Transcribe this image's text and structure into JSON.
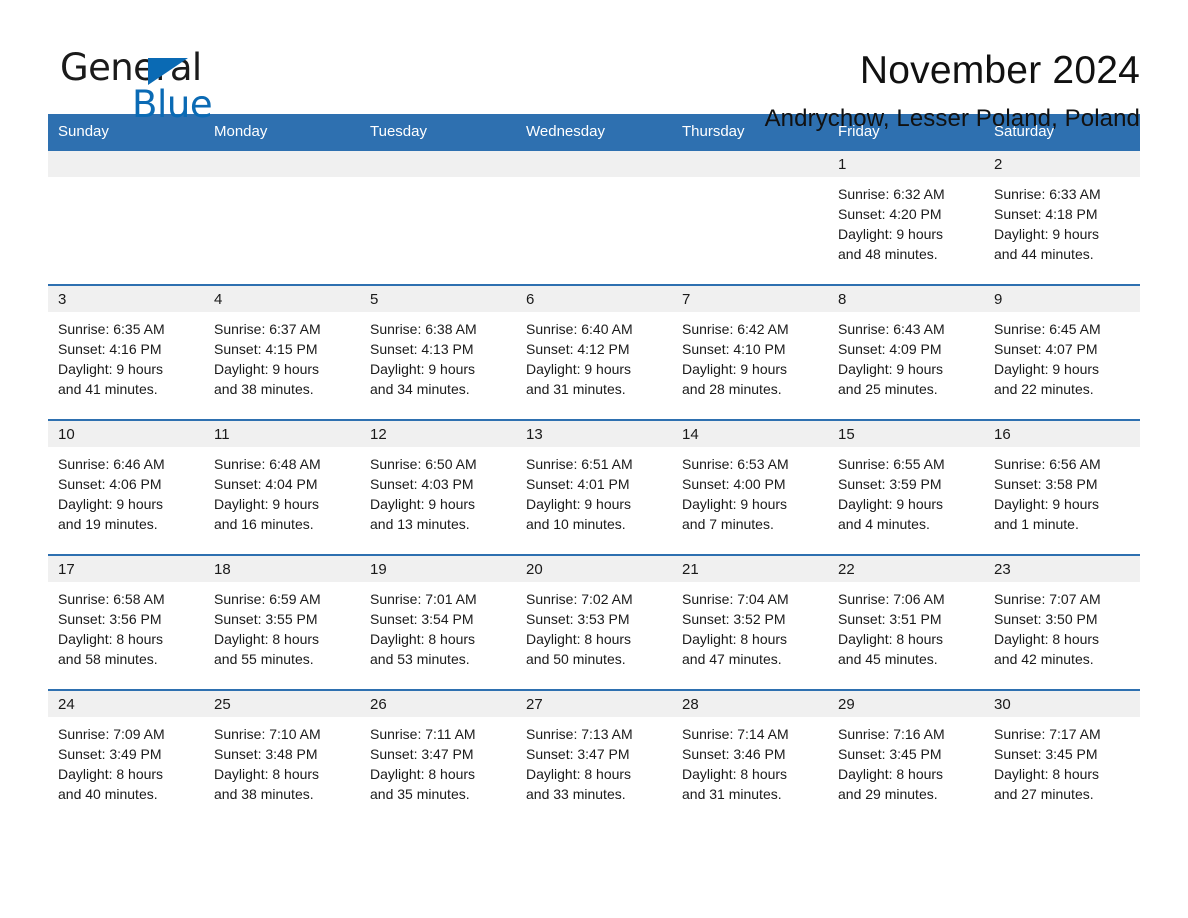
{
  "brand": {
    "name_top": "General",
    "name_bottom": "Blue",
    "accent_color": "#0a6ab4"
  },
  "header": {
    "title": "November 2024",
    "subtitle": "Andrychow, Lesser Poland, Poland"
  },
  "theme": {
    "header_blue": "#2e70b0",
    "daynum_band_gray": "#f0f0f0",
    "page_background": "#ffffff"
  },
  "weekdays": [
    "Sunday",
    "Monday",
    "Tuesday",
    "Wednesday",
    "Thursday",
    "Friday",
    "Saturday"
  ],
  "weeks": [
    [
      {
        "day": "",
        "lines": []
      },
      {
        "day": "",
        "lines": []
      },
      {
        "day": "",
        "lines": []
      },
      {
        "day": "",
        "lines": []
      },
      {
        "day": "",
        "lines": []
      },
      {
        "day": "1",
        "lines": [
          "Sunrise: 6:32 AM",
          "Sunset: 4:20 PM",
          "Daylight: 9 hours",
          "and 48 minutes."
        ]
      },
      {
        "day": "2",
        "lines": [
          "Sunrise: 6:33 AM",
          "Sunset: 4:18 PM",
          "Daylight: 9 hours",
          "and 44 minutes."
        ]
      }
    ],
    [
      {
        "day": "3",
        "lines": [
          "Sunrise: 6:35 AM",
          "Sunset: 4:16 PM",
          "Daylight: 9 hours",
          "and 41 minutes."
        ]
      },
      {
        "day": "4",
        "lines": [
          "Sunrise: 6:37 AM",
          "Sunset: 4:15 PM",
          "Daylight: 9 hours",
          "and 38 minutes."
        ]
      },
      {
        "day": "5",
        "lines": [
          "Sunrise: 6:38 AM",
          "Sunset: 4:13 PM",
          "Daylight: 9 hours",
          "and 34 minutes."
        ]
      },
      {
        "day": "6",
        "lines": [
          "Sunrise: 6:40 AM",
          "Sunset: 4:12 PM",
          "Daylight: 9 hours",
          "and 31 minutes."
        ]
      },
      {
        "day": "7",
        "lines": [
          "Sunrise: 6:42 AM",
          "Sunset: 4:10 PM",
          "Daylight: 9 hours",
          "and 28 minutes."
        ]
      },
      {
        "day": "8",
        "lines": [
          "Sunrise: 6:43 AM",
          "Sunset: 4:09 PM",
          "Daylight: 9 hours",
          "and 25 minutes."
        ]
      },
      {
        "day": "9",
        "lines": [
          "Sunrise: 6:45 AM",
          "Sunset: 4:07 PM",
          "Daylight: 9 hours",
          "and 22 minutes."
        ]
      }
    ],
    [
      {
        "day": "10",
        "lines": [
          "Sunrise: 6:46 AM",
          "Sunset: 4:06 PM",
          "Daylight: 9 hours",
          "and 19 minutes."
        ]
      },
      {
        "day": "11",
        "lines": [
          "Sunrise: 6:48 AM",
          "Sunset: 4:04 PM",
          "Daylight: 9 hours",
          "and 16 minutes."
        ]
      },
      {
        "day": "12",
        "lines": [
          "Sunrise: 6:50 AM",
          "Sunset: 4:03 PM",
          "Daylight: 9 hours",
          "and 13 minutes."
        ]
      },
      {
        "day": "13",
        "lines": [
          "Sunrise: 6:51 AM",
          "Sunset: 4:01 PM",
          "Daylight: 9 hours",
          "and 10 minutes."
        ]
      },
      {
        "day": "14",
        "lines": [
          "Sunrise: 6:53 AM",
          "Sunset: 4:00 PM",
          "Daylight: 9 hours",
          "and 7 minutes."
        ]
      },
      {
        "day": "15",
        "lines": [
          "Sunrise: 6:55 AM",
          "Sunset: 3:59 PM",
          "Daylight: 9 hours",
          "and 4 minutes."
        ]
      },
      {
        "day": "16",
        "lines": [
          "Sunrise: 6:56 AM",
          "Sunset: 3:58 PM",
          "Daylight: 9 hours",
          "and 1 minute."
        ]
      }
    ],
    [
      {
        "day": "17",
        "lines": [
          "Sunrise: 6:58 AM",
          "Sunset: 3:56 PM",
          "Daylight: 8 hours",
          "and 58 minutes."
        ]
      },
      {
        "day": "18",
        "lines": [
          "Sunrise: 6:59 AM",
          "Sunset: 3:55 PM",
          "Daylight: 8 hours",
          "and 55 minutes."
        ]
      },
      {
        "day": "19",
        "lines": [
          "Sunrise: 7:01 AM",
          "Sunset: 3:54 PM",
          "Daylight: 8 hours",
          "and 53 minutes."
        ]
      },
      {
        "day": "20",
        "lines": [
          "Sunrise: 7:02 AM",
          "Sunset: 3:53 PM",
          "Daylight: 8 hours",
          "and 50 minutes."
        ]
      },
      {
        "day": "21",
        "lines": [
          "Sunrise: 7:04 AM",
          "Sunset: 3:52 PM",
          "Daylight: 8 hours",
          "and 47 minutes."
        ]
      },
      {
        "day": "22",
        "lines": [
          "Sunrise: 7:06 AM",
          "Sunset: 3:51 PM",
          "Daylight: 8 hours",
          "and 45 minutes."
        ]
      },
      {
        "day": "23",
        "lines": [
          "Sunrise: 7:07 AM",
          "Sunset: 3:50 PM",
          "Daylight: 8 hours",
          "and 42 minutes."
        ]
      }
    ],
    [
      {
        "day": "24",
        "lines": [
          "Sunrise: 7:09 AM",
          "Sunset: 3:49 PM",
          "Daylight: 8 hours",
          "and 40 minutes."
        ]
      },
      {
        "day": "25",
        "lines": [
          "Sunrise: 7:10 AM",
          "Sunset: 3:48 PM",
          "Daylight: 8 hours",
          "and 38 minutes."
        ]
      },
      {
        "day": "26",
        "lines": [
          "Sunrise: 7:11 AM",
          "Sunset: 3:47 PM",
          "Daylight: 8 hours",
          "and 35 minutes."
        ]
      },
      {
        "day": "27",
        "lines": [
          "Sunrise: 7:13 AM",
          "Sunset: 3:47 PM",
          "Daylight: 8 hours",
          "and 33 minutes."
        ]
      },
      {
        "day": "28",
        "lines": [
          "Sunrise: 7:14 AM",
          "Sunset: 3:46 PM",
          "Daylight: 8 hours",
          "and 31 minutes."
        ]
      },
      {
        "day": "29",
        "lines": [
          "Sunrise: 7:16 AM",
          "Sunset: 3:45 PM",
          "Daylight: 8 hours",
          "and 29 minutes."
        ]
      },
      {
        "day": "30",
        "lines": [
          "Sunrise: 7:17 AM",
          "Sunset: 3:45 PM",
          "Daylight: 8 hours",
          "and 27 minutes."
        ]
      }
    ]
  ]
}
